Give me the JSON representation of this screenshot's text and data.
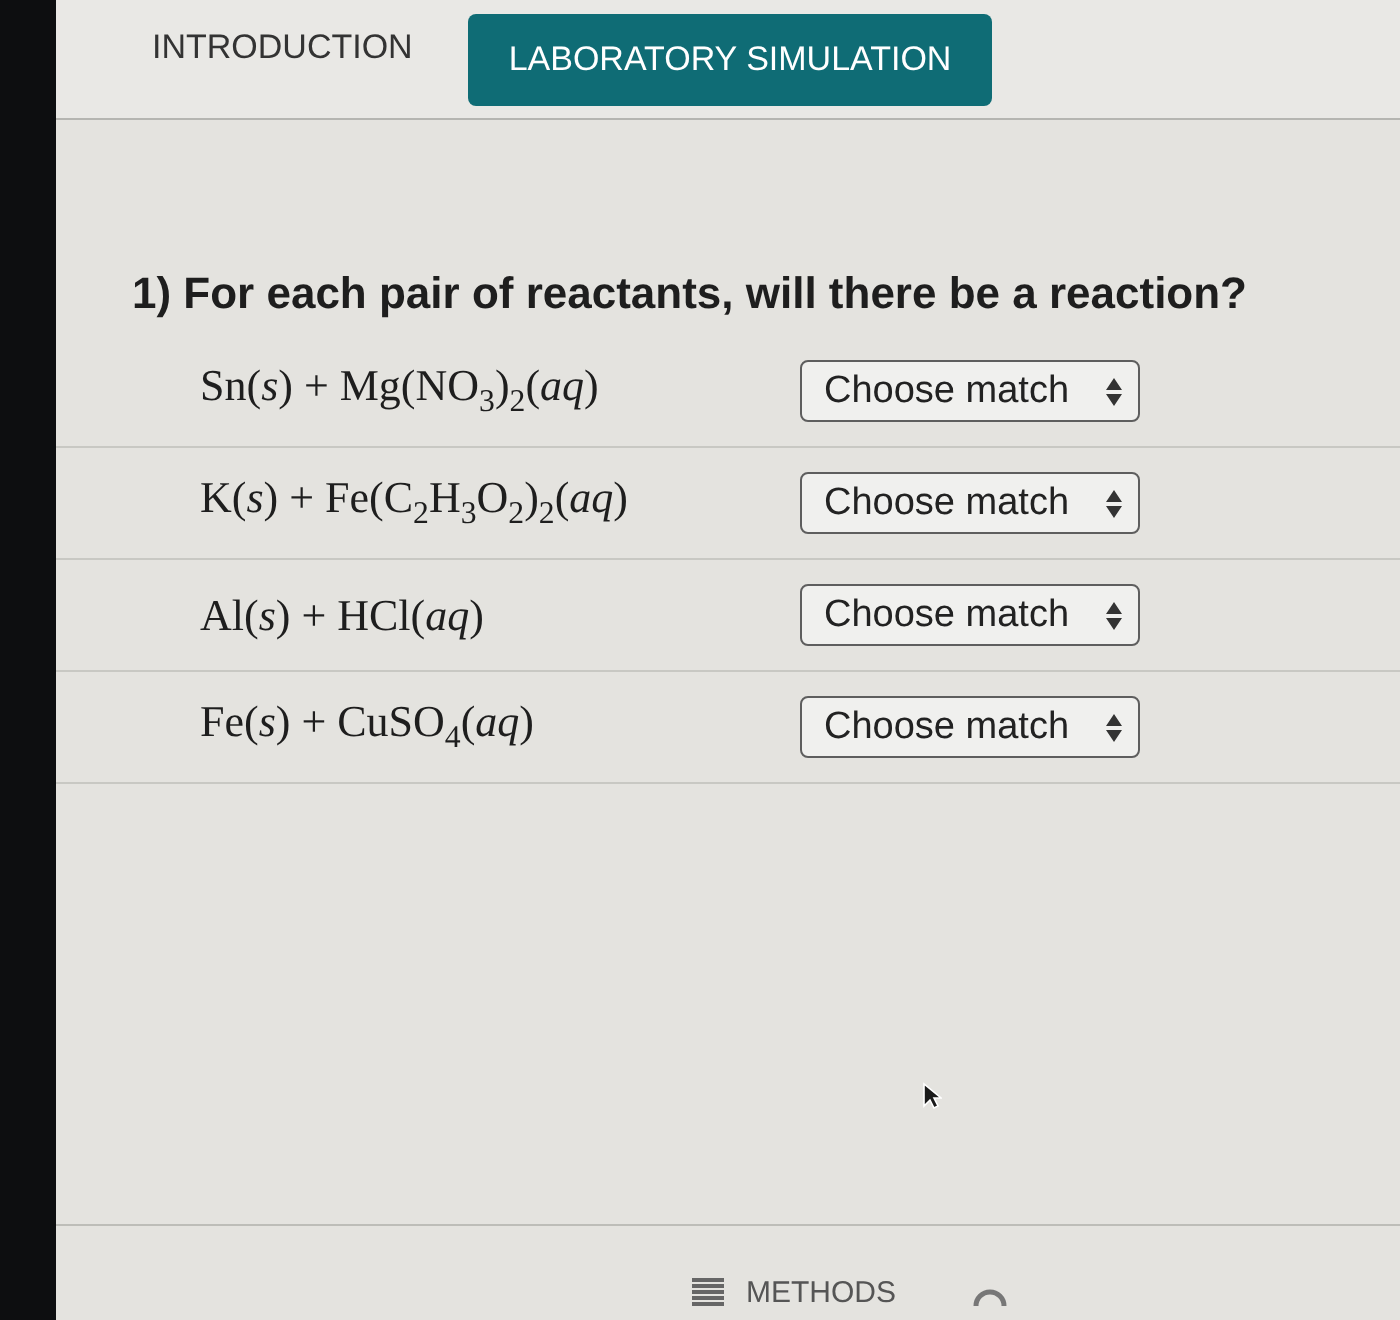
{
  "tabs": [
    {
      "label": "INTRODUCTION",
      "selected": false
    },
    {
      "label": "LABORATORY SIMULATION",
      "selected": true
    }
  ],
  "question": {
    "text": "1) For each pair of reactants, will there be a reaction?"
  },
  "pairs": [
    {
      "reactants": "Sn(*s*) + Mg(NO$_{3}$)$_{2}$(*aq*)",
      "select": {
        "value": "Choose match"
      }
    },
    {
      "reactants": "K(*s*) + Fe(C$_{2}$H$_{3}$O$_{2}$)$_{2}$(*aq*)",
      "select": {
        "value": "Choose match"
      }
    },
    {
      "reactants": "Al(*s*) + HCl(*aq*)",
      "select": {
        "value": "Choose match"
      }
    },
    {
      "reactants": "Fe(*s*) + CuSO$_{4}$(*aq*)",
      "select": {
        "value": "Choose match"
      }
    }
  ],
  "bottom_nav": [
    {
      "label": "METHODS"
    }
  ]
}
